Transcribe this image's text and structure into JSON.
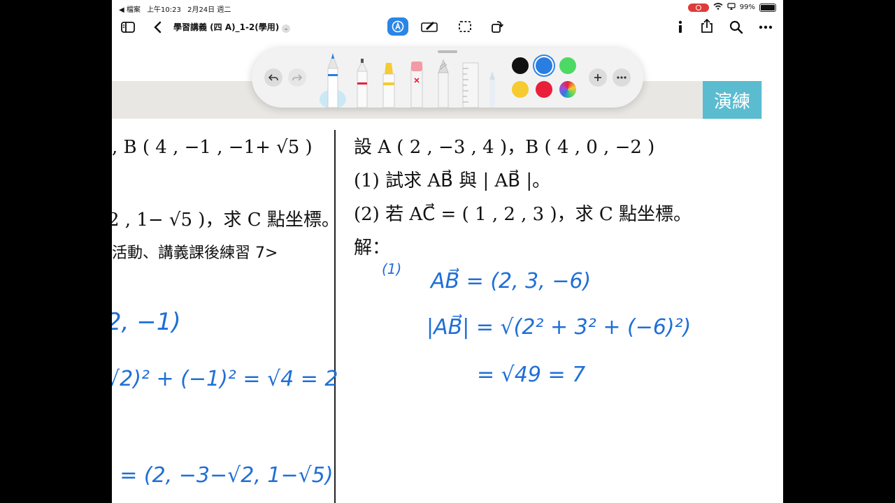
{
  "status_bar": {
    "back_app": "◀ 檔案",
    "time": "上午10:23",
    "date": "2月24日 週二",
    "battery_percent": "99%",
    "battery_level": 0.99
  },
  "toolbar": {
    "document_title": "學習講義 (四 A)_1-2(學用)"
  },
  "page": {
    "tag": "演練"
  },
  "palette": {
    "colors": [
      "#111111",
      "#2a7de1",
      "#4cd964",
      "#f5cb2f",
      "#e8203a",
      "rainbow"
    ],
    "selected_color": "#2a7de1"
  },
  "left_column": {
    "line1": ", B ( 4 , −1 , −1+ √5 )",
    "line2": "2 , 1− √5 )，求 C 點坐標。",
    "line3": "活動、講義課後練習 7>"
  },
  "right_column": {
    "line1": "設 A ( 2 , −3 , 4 )，B ( 4 , 0 , −2 )",
    "line2": "(1)  試求 AB⃗ 與 | AB⃗ |。",
    "line3": "(2)  若 AC⃗ = ( 1 , 2 , 3 )，求 C 點坐標。",
    "line4": "解："
  },
  "handwriting": {
    "left_1": "2, −1)",
    "left_2": "√2)² + (−1)² = √4 = 2",
    "left_3": ") = (2, −3−√2, 1−√5)",
    "right_label": "(1)",
    "right_1": "AB⃗ = (2, 3, −6)",
    "right_2": "|AB⃗| = √(2² + 3² + (−6)²)",
    "right_3": "= √49 = 7"
  }
}
